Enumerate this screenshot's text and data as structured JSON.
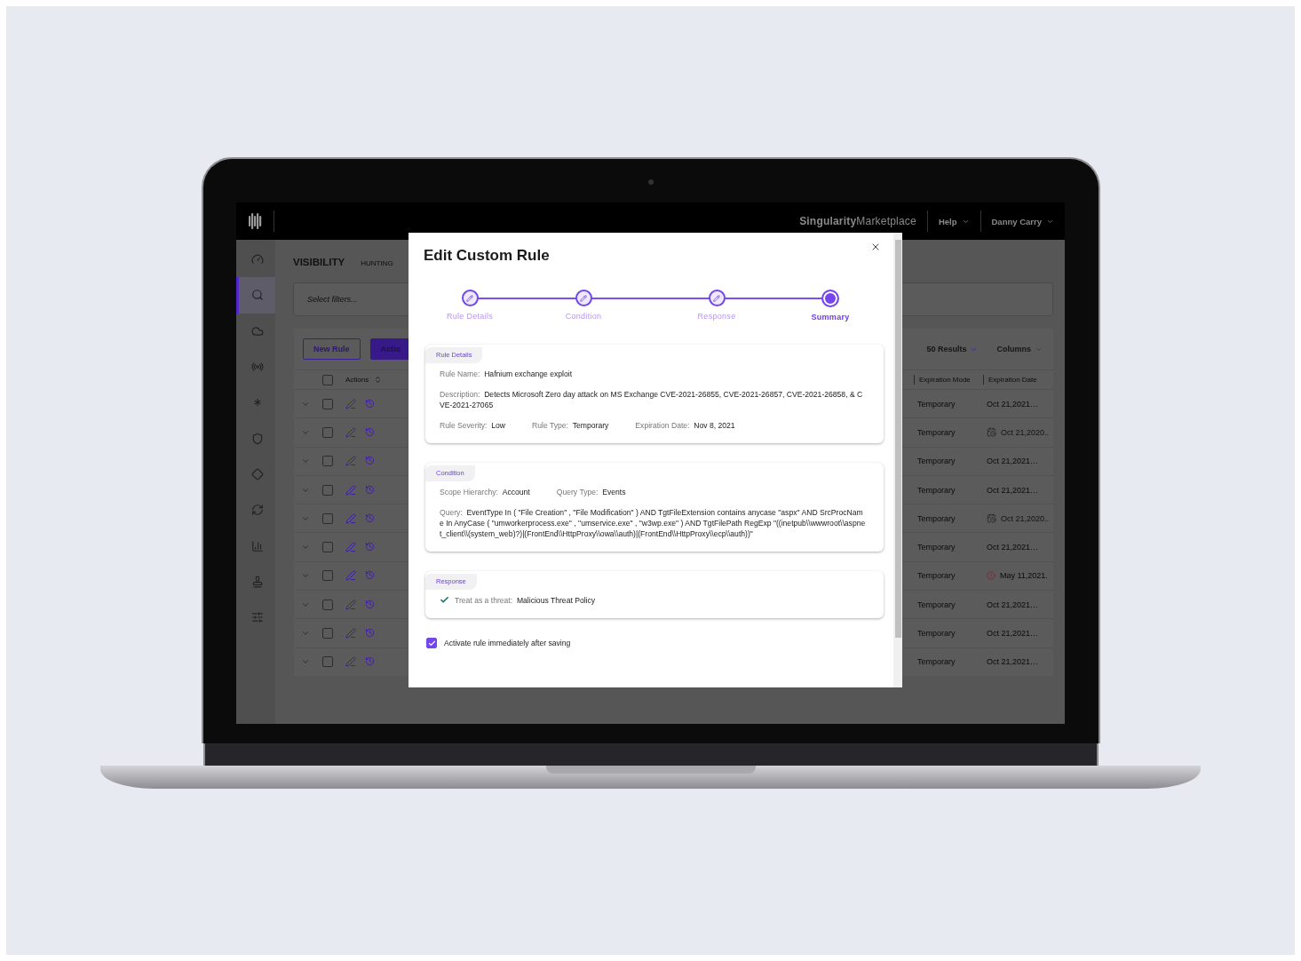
{
  "topbar": {
    "brand": "**Singularity**Marketplace",
    "menus": [
      {
        "label": "Help"
      },
      {
        "label": "Danny Carry"
      }
    ]
  },
  "sidebar": {
    "items": [
      {
        "selected": false
      },
      {
        "selected": true
      },
      {
        "selected": false
      },
      {
        "selected": false
      },
      {
        "selected": false
      },
      {
        "selected": false
      },
      {
        "selected": false
      },
      {
        "selected": false
      },
      {
        "selected": false
      },
      {
        "selected": false
      },
      {
        "selected": false
      }
    ]
  },
  "page": {
    "title": "VISIBILITY",
    "subtitle": "HUNTING"
  },
  "filter": {
    "placeholder": "Select filters..."
  },
  "toolbar": {
    "buttons": [
      {
        "label": "New Rule",
        "kind": "outline"
      },
      {
        "label": "Actio",
        "kind": "filled"
      }
    ],
    "menus": [
      {
        "label": "50 Results"
      },
      {
        "label": "Columns"
      }
    ]
  },
  "table": {
    "select_all": {
      "checked": false
    },
    "columns": [
      "Actions",
      "Expiration Mode",
      "Expiration Date"
    ],
    "rows": [
      {
        "checked": false,
        "expiration_mode": "Temporary",
        "expiration_date": "Oct 21,2021…",
        "kind": "ok"
      },
      {
        "checked": false,
        "expiration_mode": "Temporary",
        "expiration_date": "Oct 21,2020..",
        "kind": "expired"
      },
      {
        "checked": false,
        "expiration_mode": "Temporary",
        "expiration_date": "Oct 21,2021…",
        "kind": "ok"
      },
      {
        "checked": false,
        "expiration_mode": "Temporary",
        "expiration_date": "Oct 21,2021…",
        "kind": "ok"
      },
      {
        "checked": false,
        "expiration_mode": "Temporary",
        "expiration_date": "Oct 21,2020..",
        "kind": "expired"
      },
      {
        "checked": false,
        "expiration_mode": "Temporary",
        "expiration_date": "Oct 21,2021…",
        "kind": "ok"
      },
      {
        "checked": false,
        "expiration_mode": "Temporary",
        "expiration_date": "May 11,2021.",
        "kind": "warning"
      },
      {
        "checked": false,
        "expiration_mode": "Temporary",
        "expiration_date": "Oct 21,2021…",
        "kind": "ok"
      },
      {
        "checked": false,
        "expiration_mode": "Temporary",
        "expiration_date": "Oct 21,2021…",
        "kind": "ok"
      },
      {
        "checked": false,
        "expiration_mode": "Temporary",
        "expiration_date": "Oct 21,2021…",
        "kind": "ok"
      }
    ]
  },
  "modal": {
    "title": "Edit Custom Rule",
    "steps": [
      {
        "label": "Rule Details",
        "selected": false
      },
      {
        "label": "Condition",
        "selected": false
      },
      {
        "label": "Response",
        "selected": false
      },
      {
        "label": "Summary",
        "selected": true
      }
    ],
    "sections": [
      {
        "title": "Rule Details",
        "rows": [
          [
            {
              "kind": "plain",
              "label": "Rule Name:",
              "value": "Hafnium exchange exploit"
            }
          ],
          [
            {
              "kind": "plain",
              "label": "Description:",
              "value": "Detects Microsoft Zero day attack on MS Exchange CVE-2021-26855, CVE-2021-26857, CVE-2021-26858, & CVE-2021-27065"
            }
          ],
          [
            {
              "kind": "plain",
              "label": "Rule Severity:",
              "value": "Low"
            },
            {
              "kind": "plain",
              "label": "Rule Type:",
              "value": "Temporary"
            },
            {
              "kind": "plain",
              "label": "Expiration Date:",
              "value": "Nov 8, 2021"
            }
          ]
        ]
      },
      {
        "title": "Condition",
        "rows": [
          [
            {
              "kind": "plain",
              "label": "Scope Hierarchy:",
              "value": "Account"
            },
            {
              "kind": "plain",
              "label": "Query Type:",
              "value": "Events"
            }
          ],
          [
            {
              "kind": "plain",
              "label": "Query:",
              "value": "EventType In ( \"File Creation\" , \"File Modification\" ) AND TgtFileExtension contains anycase \"aspx\" AND SrcProcName In AnyCase ( \"umworkerprocess.exe\" , \"umservice.exe\" , \"w3wp.exe\" ) AND TgtFilePath RegExp \"((inetpub\\\\wwwroot\\\\aspnet_client\\\\(system_web)?)|(FrontEnd\\\\HttpProxy\\\\owa\\\\auth)|(FrontEnd\\\\HttpProxy\\\\ecp\\\\auth))\""
            }
          ]
        ]
      },
      {
        "title": "Response",
        "rows": [
          [
            {
              "kind": "check",
              "label": "Treat as a threat:",
              "value": "Malicious Threat Policy"
            }
          ]
        ]
      }
    ],
    "activate": {
      "label": "Activate rule immediately after saving",
      "checked": true
    }
  }
}
